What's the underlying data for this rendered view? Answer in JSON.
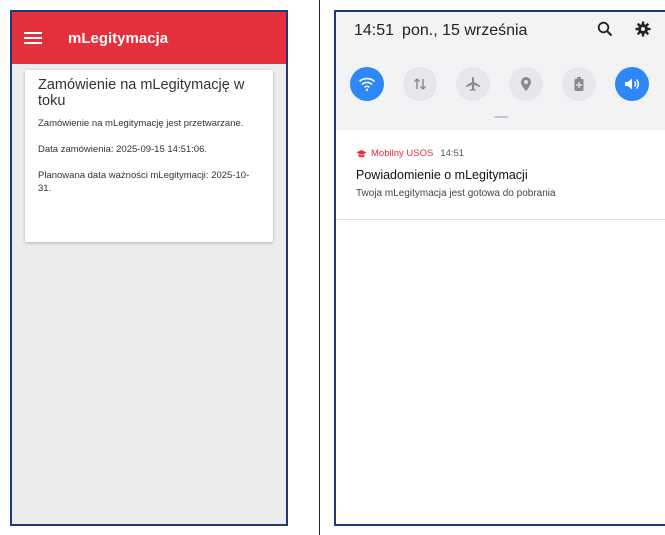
{
  "left_app": {
    "title": "mLegitymacja",
    "card": {
      "title": "Zamówienie na mLegitymację w toku",
      "status": "Zamówienie na mLegitymację jest przetwarzane.",
      "order_date": "Data zamówienia: 2025-09-15 14:51:06.",
      "validity": "Planowana data ważności mLegitymacji: 2025-10-31."
    }
  },
  "status_bar": {
    "time": "14:51",
    "date": "pon., 15 września"
  },
  "quick_settings": [
    {
      "icon": "wifi-icon",
      "active": true
    },
    {
      "icon": "mobile-data-icon",
      "active": false
    },
    {
      "icon": "airplane-mode-icon",
      "active": false
    },
    {
      "icon": "location-icon",
      "active": false
    },
    {
      "icon": "battery-saver-icon",
      "active": false
    },
    {
      "icon": "sound-icon",
      "active": true
    }
  ],
  "notification": {
    "app_name": "Mobilny USOS",
    "time": "14:51",
    "title": "Powiadomienie o mLegitymacji",
    "body": "Twoja mLegitymacja jest gotowa do pobrania"
  },
  "colors": {
    "brand_red": "#e52f3a",
    "accent_blue": "#2f86f6",
    "frame_border": "#1f3a78"
  }
}
